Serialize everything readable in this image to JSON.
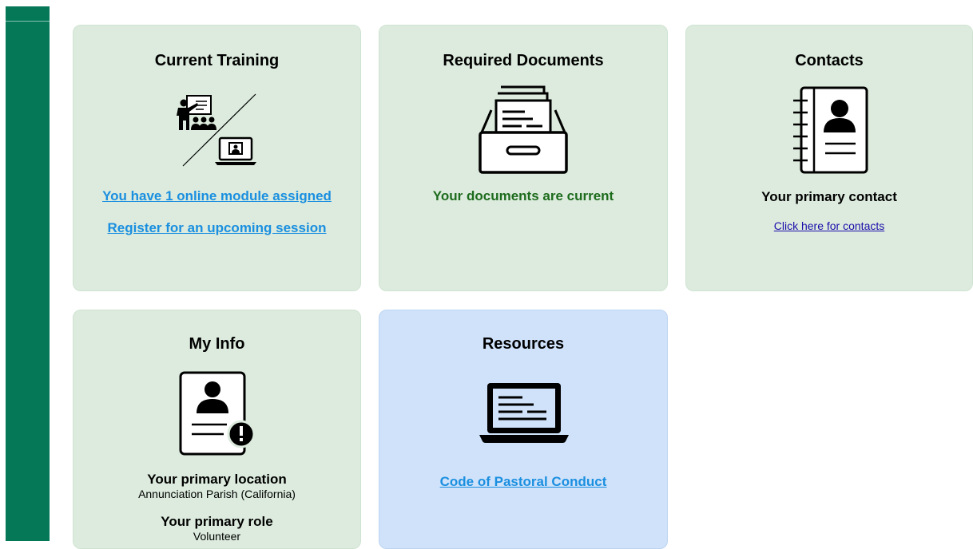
{
  "colors": {
    "sidebar": "#047857",
    "card_green": "#dcebdd",
    "card_blue": "#cfe2fa",
    "link": "#1a8fe0",
    "status_ok": "#1d6b1d"
  },
  "training": {
    "title": "Current Training",
    "icon": "training-classroom-online-icon",
    "link_modules": "You have 1 online module assigned",
    "link_register": "Register for an upcoming session"
  },
  "documents": {
    "title": "Required Documents",
    "icon": "file-drawer-icon",
    "status": "Your documents are current"
  },
  "contacts": {
    "title": "Contacts",
    "icon": "address-book-icon",
    "heading": "Your primary contact",
    "link": "Click here for contacts"
  },
  "myinfo": {
    "title": "My Info",
    "icon": "profile-alert-icon",
    "location_label": "Your primary location",
    "location_value": "Annunciation Parish (California)",
    "role_label": "Your primary role",
    "role_value": "Volunteer"
  },
  "resources": {
    "title": "Resources",
    "icon": "laptop-document-icon",
    "link": "Code of Pastoral Conduct"
  }
}
